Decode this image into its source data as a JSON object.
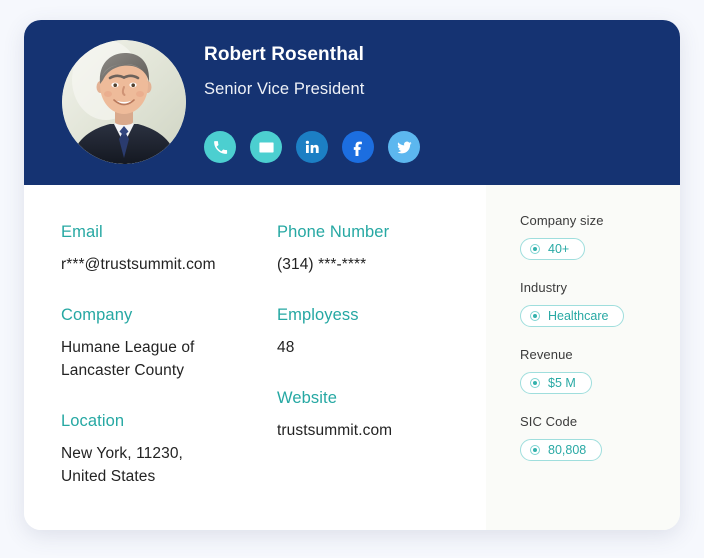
{
  "header": {
    "name": "Robert Rosenthal",
    "title": "Senior Vice President",
    "avatar_alt": "profile-photo",
    "socials": [
      {
        "name": "phone-icon",
        "label": "Phone"
      },
      {
        "name": "email-icon",
        "label": "Email"
      },
      {
        "name": "linkedin-icon",
        "label": "LinkedIn"
      },
      {
        "name": "facebook-icon",
        "label": "Facebook"
      },
      {
        "name": "twitter-icon",
        "label": "Twitter"
      }
    ],
    "bg_color": "#153372"
  },
  "details": {
    "left": [
      {
        "label": "Email",
        "value": "r***@trustsummit.com"
      },
      {
        "label": "Company",
        "value": "Humane League of\nLancaster County"
      },
      {
        "label": "Location",
        "value": "New York, 11230,\nUnited States"
      }
    ],
    "right": [
      {
        "label": "Phone Number",
        "value": "(314) ***-****"
      },
      {
        "label": "Employess",
        "value": "48"
      },
      {
        "label": "Website",
        "value": "trustsummit.com"
      }
    ],
    "label_color": "#26a8a3"
  },
  "aside": {
    "blocks": [
      {
        "label": "Company size",
        "value": "40+"
      },
      {
        "label": "Industry",
        "value": "Healthcare"
      },
      {
        "label": "Revenue",
        "value": "$5 M"
      },
      {
        "label": "SIC Code",
        "value": "80,808"
      }
    ],
    "pill_color": "#29a9a4",
    "bg_color": "#fafbf8"
  }
}
